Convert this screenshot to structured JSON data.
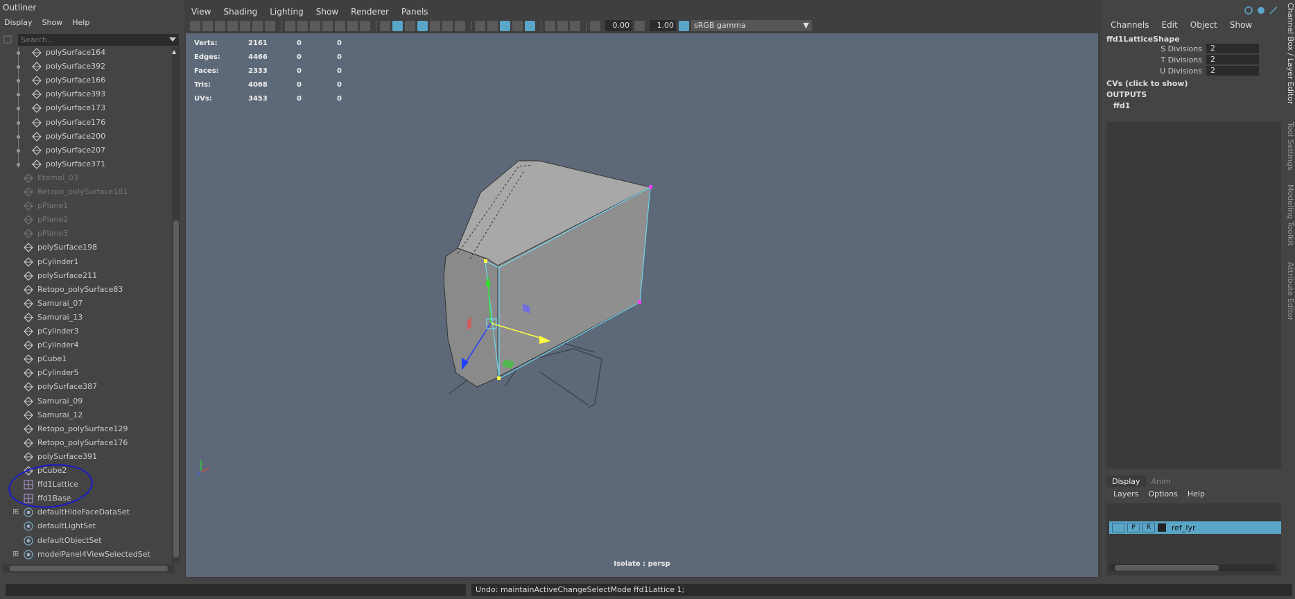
{
  "outliner": {
    "title": "Outliner",
    "menu": [
      "Display",
      "Show",
      "Help"
    ],
    "search_placeholder": "Search...",
    "items": [
      {
        "label": "polySurface164",
        "dim": false,
        "child": true
      },
      {
        "label": "polySurface392",
        "dim": false,
        "child": true
      },
      {
        "label": "polySurface166",
        "dim": false,
        "child": true
      },
      {
        "label": "polySurface393",
        "dim": false,
        "child": true
      },
      {
        "label": "polySurface173",
        "dim": false,
        "child": true
      },
      {
        "label": "polySurface176",
        "dim": false,
        "child": true
      },
      {
        "label": "polySurface200",
        "dim": false,
        "child": true
      },
      {
        "label": "polySurface207",
        "dim": false,
        "child": true
      },
      {
        "label": "polySurface371",
        "dim": false,
        "child": true
      },
      {
        "label": "Eternal_03",
        "dim": true
      },
      {
        "label": "Retopo_polySurface181",
        "dim": true
      },
      {
        "label": "pPlane1",
        "dim": true
      },
      {
        "label": "pPlane2",
        "dim": true
      },
      {
        "label": "pPlane3",
        "dim": true
      },
      {
        "label": "polySurface198",
        "dim": false
      },
      {
        "label": "pCylinder1",
        "dim": false
      },
      {
        "label": "polySurface211",
        "dim": false
      },
      {
        "label": "Retopo_polySurface83",
        "dim": false
      },
      {
        "label": "Samurai_07",
        "dim": false
      },
      {
        "label": "Samurai_13",
        "dim": false
      },
      {
        "label": "pCylinder3",
        "dim": false
      },
      {
        "label": "pCylinder4",
        "dim": false
      },
      {
        "label": "pCube1",
        "dim": false
      },
      {
        "label": "pCylinder5",
        "dim": false
      },
      {
        "label": "polySurface387",
        "dim": false
      },
      {
        "label": "Samurai_09",
        "dim": false
      },
      {
        "label": "Samurai_12",
        "dim": false
      },
      {
        "label": "Retopo_polySurface129",
        "dim": false
      },
      {
        "label": "Retopo_polySurface176",
        "dim": false
      },
      {
        "label": "polySurface391",
        "dim": false
      },
      {
        "label": "pCube2",
        "dim": false
      },
      {
        "label": "ffd1Lattice",
        "dim": false,
        "icon": "lattice"
      },
      {
        "label": "ffd1Base",
        "dim": false,
        "icon": "lattice"
      },
      {
        "label": "defaultHideFaceDataSet",
        "dim": false,
        "icon": "set",
        "expand": true
      },
      {
        "label": "defaultLightSet",
        "dim": false,
        "icon": "set"
      },
      {
        "label": "defaultObjectSet",
        "dim": false,
        "icon": "set"
      },
      {
        "label": "modelPanel4ViewSelectedSet",
        "dim": false,
        "icon": "set",
        "expand": true
      }
    ]
  },
  "viewport": {
    "menu": [
      "View",
      "Shading",
      "Lighting",
      "Show",
      "Renderer",
      "Panels"
    ],
    "exposure": "0.00",
    "gamma": "1.00",
    "color_space": "sRGB gamma",
    "stats": [
      {
        "name": "Verts:",
        "a": "2161",
        "b": "0",
        "c": "0"
      },
      {
        "name": "Edges:",
        "a": "4466",
        "b": "0",
        "c": "0"
      },
      {
        "name": "Faces:",
        "a": "2333",
        "b": "0",
        "c": "0"
      },
      {
        "name": "Tris:",
        "a": "4068",
        "b": "0",
        "c": "0"
      },
      {
        "name": "UVs:",
        "a": "3453",
        "b": "0",
        "c": "0"
      }
    ],
    "isolate_label": "Isolate : persp"
  },
  "channel_box": {
    "menu": [
      "Channels",
      "Edit",
      "Object",
      "Show"
    ],
    "node": "ffd1LatticeShape",
    "attributes": [
      {
        "name": "S Divisions",
        "value": "2"
      },
      {
        "name": "T Divisions",
        "value": "2"
      },
      {
        "name": "U Divisions",
        "value": "2"
      }
    ],
    "cvs": "CVs (click to show)",
    "outputs": "OUTPUTS",
    "output_node": "ffd1",
    "layer_tabs": [
      "Display",
      "Anim"
    ],
    "layer_menu": [
      "Layers",
      "Options",
      "Help"
    ],
    "layer": {
      "p": "P",
      "r": "R",
      "name": "ref_lyr"
    },
    "side_tabs": [
      "Channel Box / Layer Editor",
      "Tool Settings",
      "Modeling Toolkit",
      "Attribute Editor"
    ]
  },
  "command_line": {
    "output": "Undo: maintainActiveChangeSelectMode ffd1Lattice 1;"
  }
}
